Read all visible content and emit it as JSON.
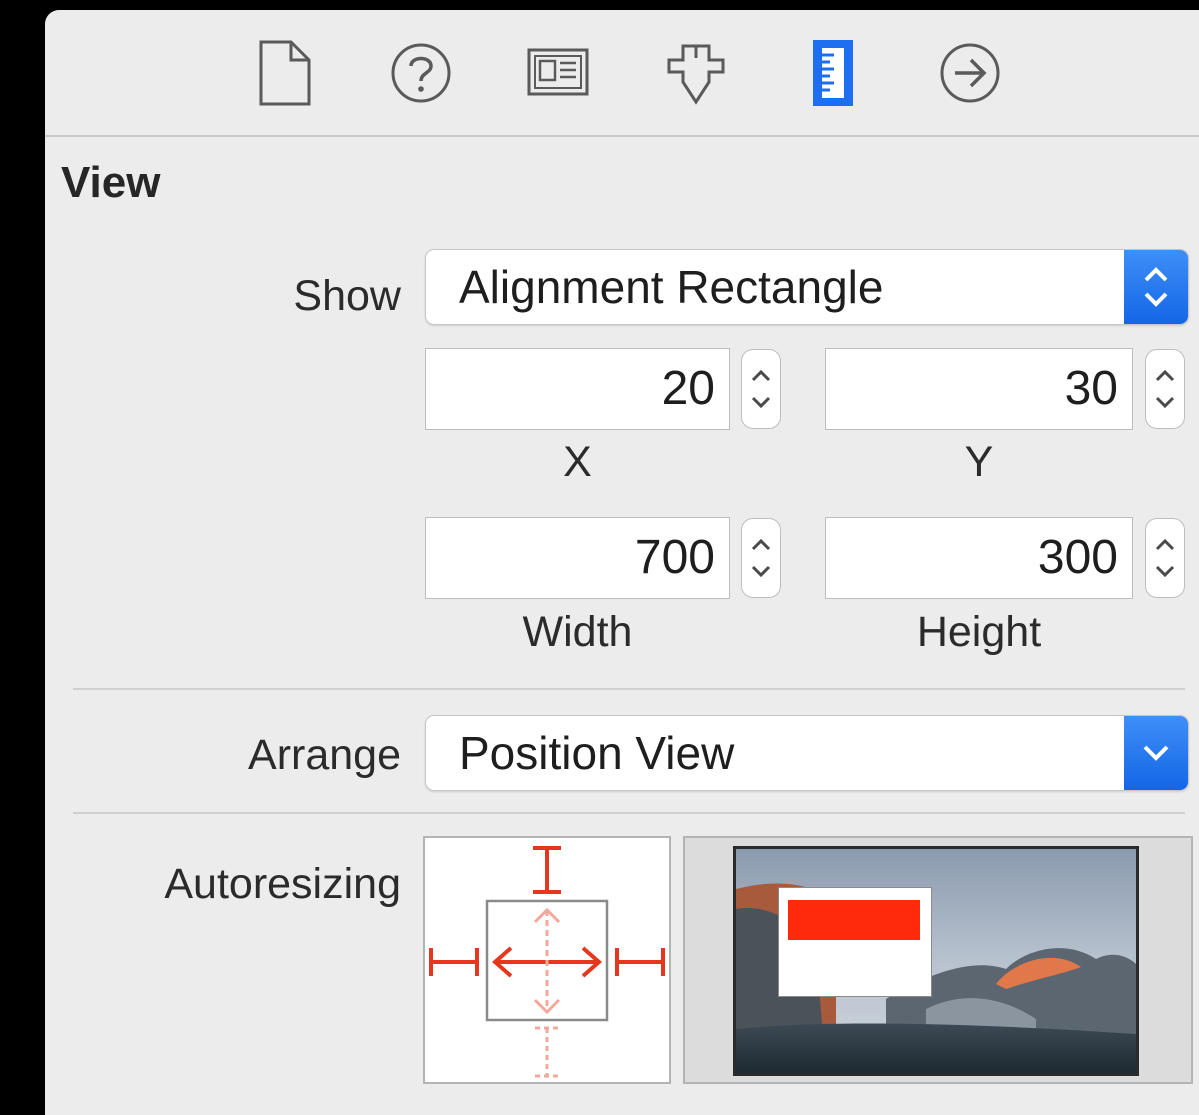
{
  "toolbar": {
    "tabs": [
      {
        "name": "file-inspector",
        "icon": "document-icon"
      },
      {
        "name": "quick-help",
        "icon": "question-circle-icon"
      },
      {
        "name": "identity-inspector",
        "icon": "identity-card-icon"
      },
      {
        "name": "attributes-inspector",
        "icon": "attributes-slider-icon"
      },
      {
        "name": "size-inspector",
        "icon": "ruler-icon",
        "selected": true
      },
      {
        "name": "connections-inspector",
        "icon": "arrow-circle-icon"
      }
    ],
    "selected_color": "#1d6ef0"
  },
  "section": {
    "title": "View"
  },
  "show": {
    "label": "Show",
    "value": "Alignment Rectangle"
  },
  "frame": {
    "x": {
      "value": "20",
      "caption": "X"
    },
    "y": {
      "value": "30",
      "caption": "Y"
    },
    "width": {
      "value": "700",
      "caption": "Width"
    },
    "height": {
      "value": "300",
      "caption": "Height"
    }
  },
  "arrange": {
    "label": "Arrange",
    "value": "Position View"
  },
  "autoresizing": {
    "label": "Autoresizing"
  },
  "colors": {
    "accent_blue": "#1d6ef0",
    "strut_red": "#e5371e",
    "strut_inactive": "#f2a89a",
    "panel_bg": "#ececec"
  }
}
